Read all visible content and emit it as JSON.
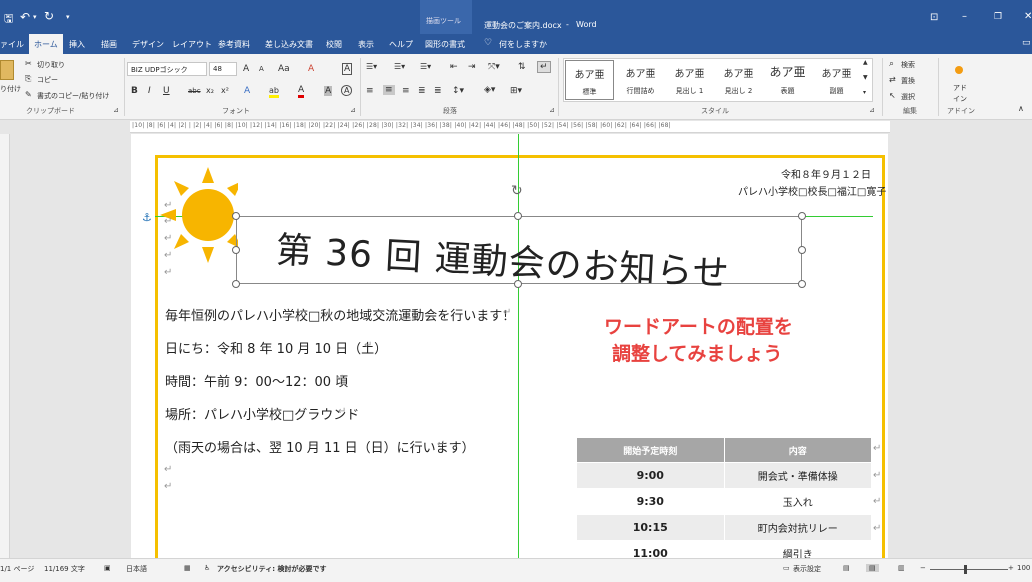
{
  "titlebar": {
    "qat_save": "🖫",
    "qat_undo": "↶",
    "qat_redo": "↻",
    "qat_more": "▾",
    "context_group": "描画ツール",
    "doc_title": "運動会のご案内.docx",
    "separator": "-",
    "app_name": "Word",
    "win_restore_ribbon": "⊡",
    "win_minimize": "–",
    "win_maximize": "❐",
    "win_close": "✕"
  },
  "tabs": [
    "ァイル",
    "ホーム",
    "挿入",
    "描画",
    "デザイン",
    "レイアウト",
    "参考資料",
    "差し込み文書",
    "校閲",
    "表示",
    "ヘルプ",
    "図形の書式"
  ],
  "tellme": "何をしますか",
  "ribbon": {
    "clipboard": {
      "paste": "り付け",
      "cut": "切り取り",
      "copy": "コピー",
      "format_painter": "書式のコピー/貼り付け",
      "group": "クリップボード"
    },
    "font": {
      "name": "BIZ UDPゴシック",
      "size": "48",
      "grow": "A",
      "shrink": "A",
      "case": "Aa",
      "clear": "A",
      "char_border": "A",
      "bold": "B",
      "italic": "I",
      "underline": "U",
      "strike": "abc",
      "sub": "x₂",
      "sup": "x²",
      "effects": "A",
      "highlight": "ab",
      "color": "A",
      "shade": "A",
      "enclosed": "A",
      "group": "フォント"
    },
    "paragraph": {
      "group": "段落"
    },
    "styles": {
      "items": [
        {
          "preview": "あア亜",
          "name": "標準"
        },
        {
          "preview": "あア亜",
          "name": "行間詰め"
        },
        {
          "preview": "あア亜",
          "name": "見出し 1"
        },
        {
          "preview": "あア亜",
          "name": "見出し 2"
        },
        {
          "preview": "あア亜",
          "name": "表題"
        },
        {
          "preview": "あア亜",
          "name": "副題"
        }
      ],
      "group": "スタイル"
    },
    "editing": {
      "find": "検索",
      "replace": "置換",
      "select": "選択",
      "group": "編集"
    },
    "addins": {
      "label1": "アド",
      "label2": "イン",
      "group": "アドイン"
    }
  },
  "ruler": "|10| |8| |6| |4| |2| | |2| |4| |6| |8| |10| |12| |14| |16| |18| |20| |22| |24| |26| |28| |30| |32| |34| |36| |38| |40| |42| |44| |46| |48| |50| |52| |54| |56| |58| |60| |62| |64| |66| |68|",
  "document": {
    "date": "令和８年９月１２日",
    "principal": "パレハ小学校□校長□福江□寛子",
    "wordart": "第 36 回 運動会のお知らせ",
    "para1": "毎年恒例のパレハ小学校□秋の地域交流運動会を行います！",
    "para2": "日にち：令和 8 年 10 月 10 日（土）",
    "para3": "時間：午前 9：00～12：00 頃",
    "para4": "場所：パレハ小学校□グラウンド",
    "para5": "（雨天の場合は、翌 10 月 11 日（日）に行います）",
    "callout1": "ワードアートの配置を",
    "callout2": "調整してみましょう",
    "mark": "↵",
    "table_headers": [
      "開始予定時刻",
      "内容"
    ],
    "table_rows": [
      {
        "time": "9:00",
        "item": "開会式・準備体操"
      },
      {
        "time": "9:30",
        "item": "玉入れ"
      },
      {
        "time": "10:15",
        "item": "町内会対抗リレー"
      },
      {
        "time": "11:00",
        "item": "綱引き"
      }
    ]
  },
  "statusbar": {
    "page": "1/1 ページ",
    "words": "11/169 文字",
    "lang": "日本語",
    "accessibility": "アクセシビリティ: 検討が必要です",
    "display_settings": "表示設定",
    "zoom_minus": "−",
    "zoom_plus": "+",
    "zoom": "100"
  },
  "colors": {
    "word_blue": "#2b579a",
    "border_yellow": "#f5c000",
    "callout_red": "#e8423f",
    "sun": "#f7b500",
    "guide_green": "#33cc33"
  }
}
